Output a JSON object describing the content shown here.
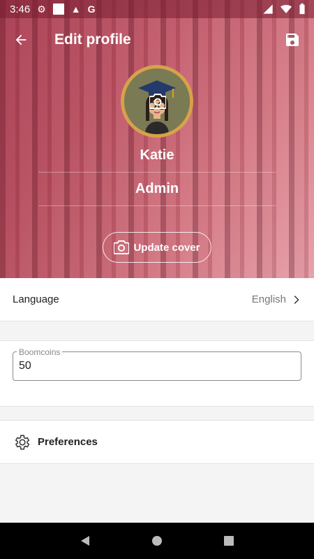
{
  "status_bar": {
    "time": "3:46"
  },
  "header": {
    "title": "Edit profile"
  },
  "profile": {
    "name": "Katie",
    "role": "Admin",
    "update_cover_label": "Update cover"
  },
  "language": {
    "label": "Language",
    "value": "English"
  },
  "boomcoins": {
    "label": "Boomcoins",
    "value": "50"
  },
  "preferences": {
    "label": "Preferences"
  },
  "icons": {
    "back": "arrow-left-icon",
    "save": "save-icon",
    "camera": "camera-icon",
    "chevron": "chevron-right-icon",
    "gear": "gear-icon"
  },
  "colors": {
    "cover_tint": "#c35c6d",
    "avatar_ring": "#d6a24a"
  }
}
